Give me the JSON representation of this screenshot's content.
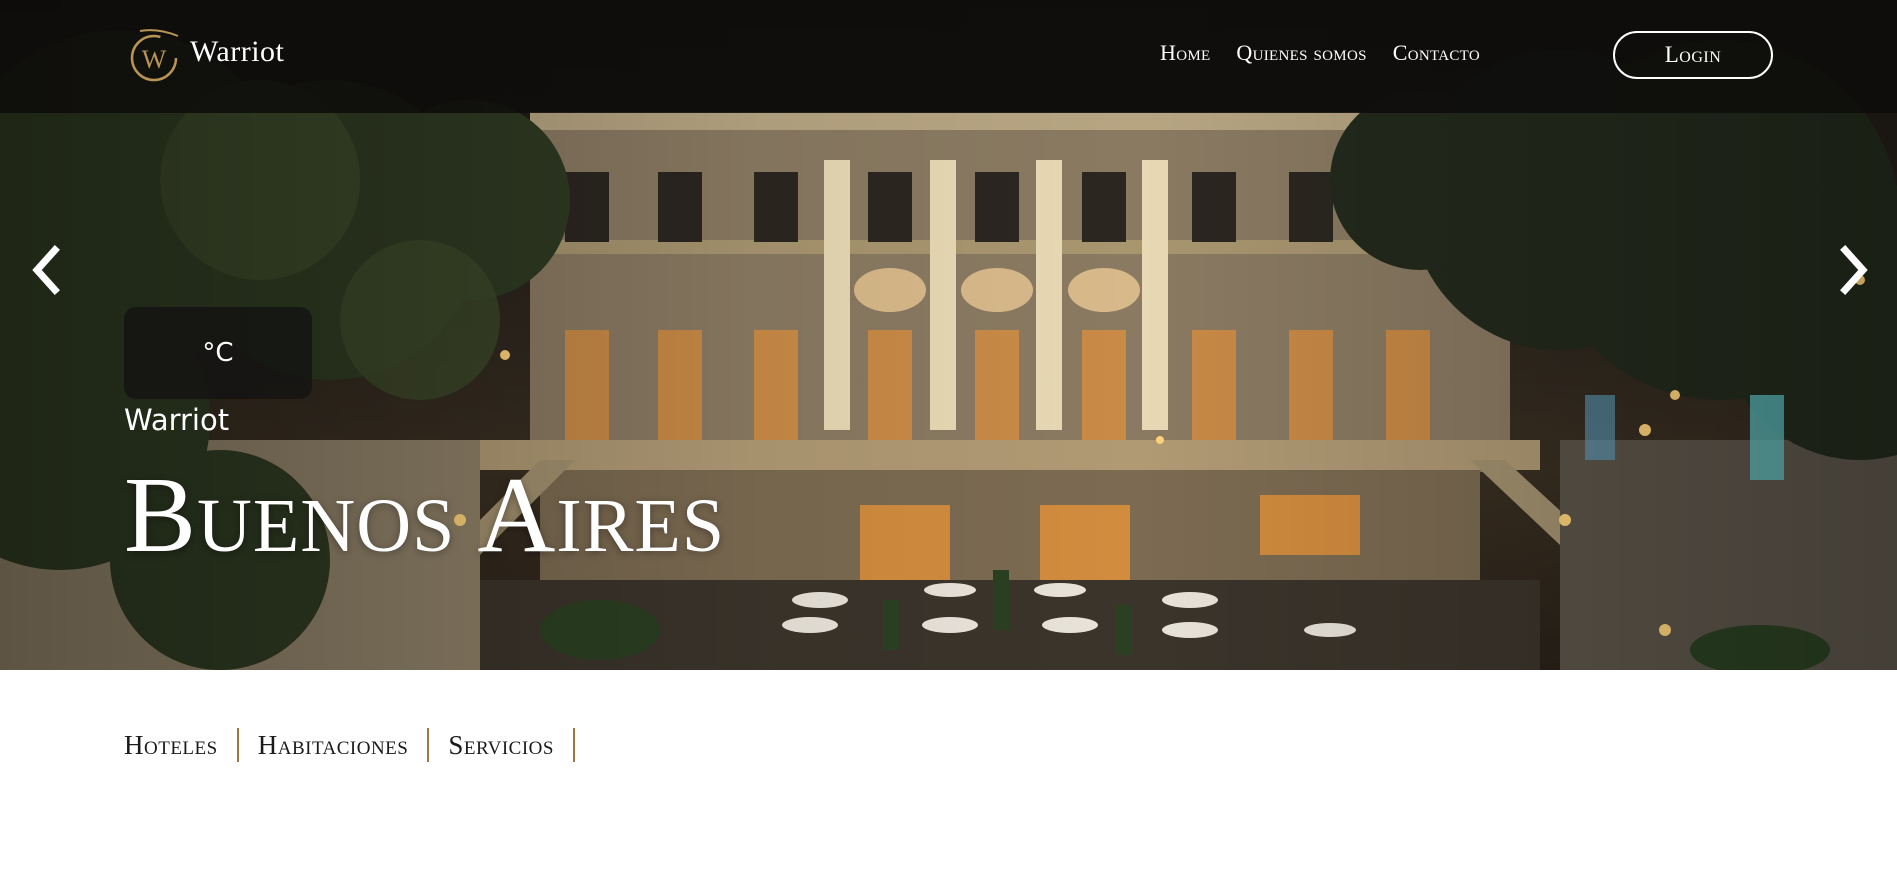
{
  "header": {
    "brand": "Warriot",
    "logo_letter": "W",
    "nav": [
      "Home",
      "Quienes somos",
      "Contacto"
    ],
    "login_label": "Login"
  },
  "hero": {
    "weather_unit": "°C",
    "subtitle": "Warriot",
    "title": "Buenos Aires",
    "prev_icon": "chevron-left-icon",
    "next_icon": "chevron-right-icon"
  },
  "tabs": [
    "Hoteles",
    "Habitaciones",
    "Servicios"
  ],
  "colors": {
    "accent": "#a0783c",
    "logo_gold": "#b89456",
    "header_bg": "#0e0d0b"
  }
}
